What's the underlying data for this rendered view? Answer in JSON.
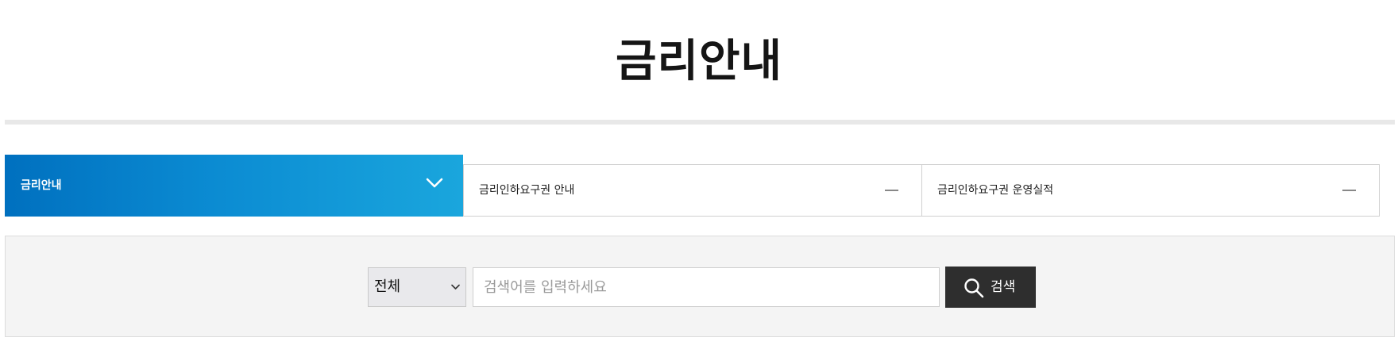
{
  "page": {
    "title": "금리안내"
  },
  "tabs": [
    {
      "label": "금리안내",
      "state": "active",
      "icon": "chevron-down-icon"
    },
    {
      "label": "금리인하요구권 안내",
      "state": "collapsed",
      "icon": "minus-icon"
    },
    {
      "label": "금리인하요구권 운영실적",
      "state": "collapsed",
      "icon": "minus-icon"
    }
  ],
  "search": {
    "category_selected": "전체",
    "placeholder": "검색어를 입력하세요",
    "value": "",
    "button_label": "검색",
    "button_icon": "search-icon"
  },
  "colors": {
    "active_tab_start": "#0070bf",
    "active_tab_end": "#1aa6dd",
    "search_button": "#2e2e2e",
    "panel_background": "#f4f4f4"
  }
}
